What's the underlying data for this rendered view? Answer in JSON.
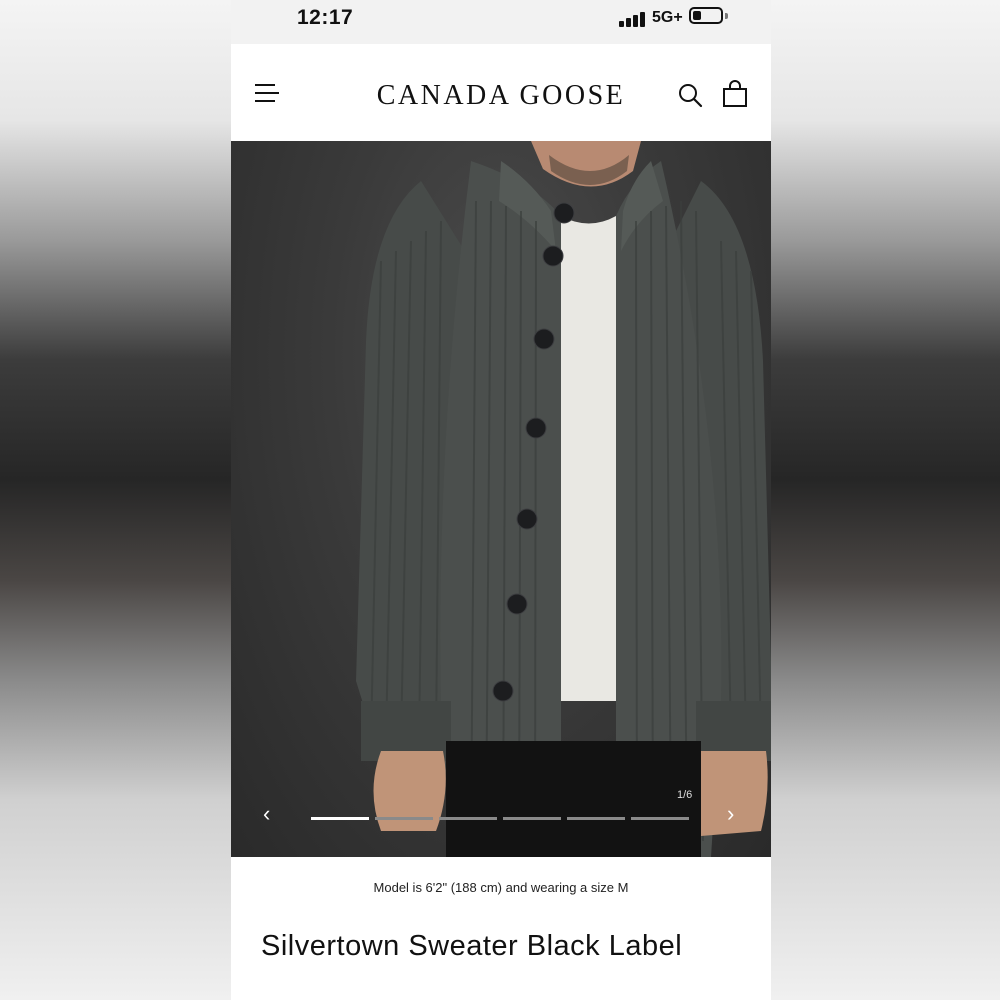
{
  "status_bar": {
    "time": "12:17",
    "network": "5G+"
  },
  "header": {
    "brand": "CANADA GOOSE",
    "icons": [
      "menu-icon",
      "search-icon",
      "shopping-bag-icon"
    ]
  },
  "gallery": {
    "counter": "1/6",
    "image_subject": "grey ribbed knit button-up sweater on model",
    "prev_icon": "chevron-left-icon",
    "next_icon": "chevron-right-icon",
    "current_index": 1,
    "total_images": 6
  },
  "product": {
    "model_caption": "Model is 6'2\" (188 cm) and wearing a size M",
    "title": "Silvertown Sweater Black Label"
  },
  "colors": {
    "sweater": "#4a4e4c",
    "background": "#3a3a3a",
    "text": "#111111"
  }
}
